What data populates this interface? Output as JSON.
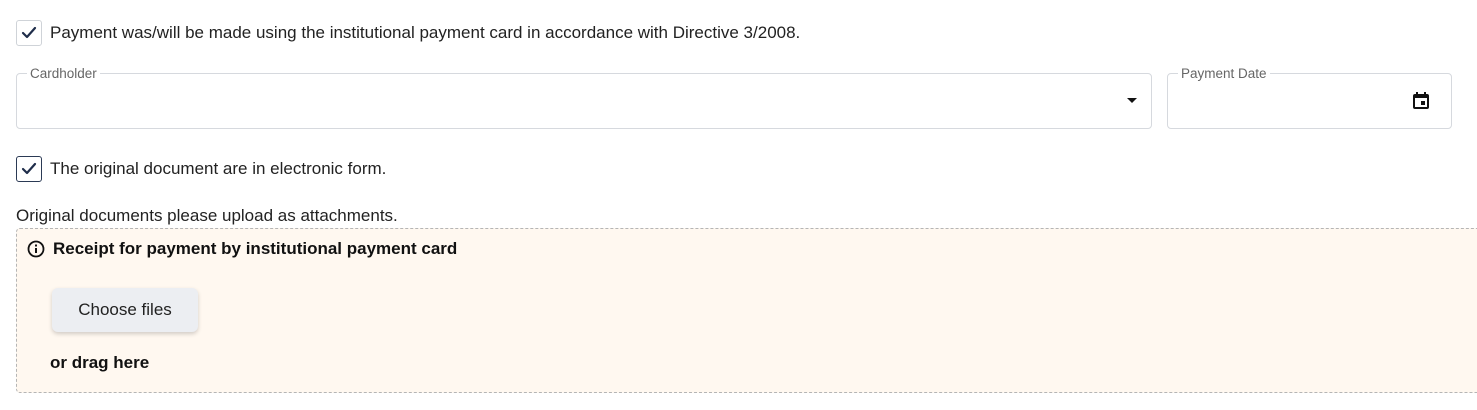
{
  "payment_card_checkbox": {
    "checked": true,
    "label": "Payment was/will be made using the institutional payment card in accordance with Directive 3/2008."
  },
  "cardholder": {
    "legend": "Cardholder",
    "value": "",
    "icon": "chevron-down-icon"
  },
  "payment_date": {
    "legend": "Payment Date",
    "value": "",
    "icon": "calendar-icon"
  },
  "electronic_checkbox": {
    "checked": true,
    "label": "The original document are in electronic form."
  },
  "upload_hint": "Original documents please upload as attachments.",
  "dropzone": {
    "title": "Receipt for payment by institutional payment card",
    "info_icon": "info-icon",
    "choose_button": "Choose files",
    "drag_text": "or drag here"
  },
  "colors": {
    "check": "#1f2d4a",
    "dropzone_bg": "#fff8f0",
    "dropzone_border": "#b5b5b5",
    "button_bg": "#eceef2"
  }
}
